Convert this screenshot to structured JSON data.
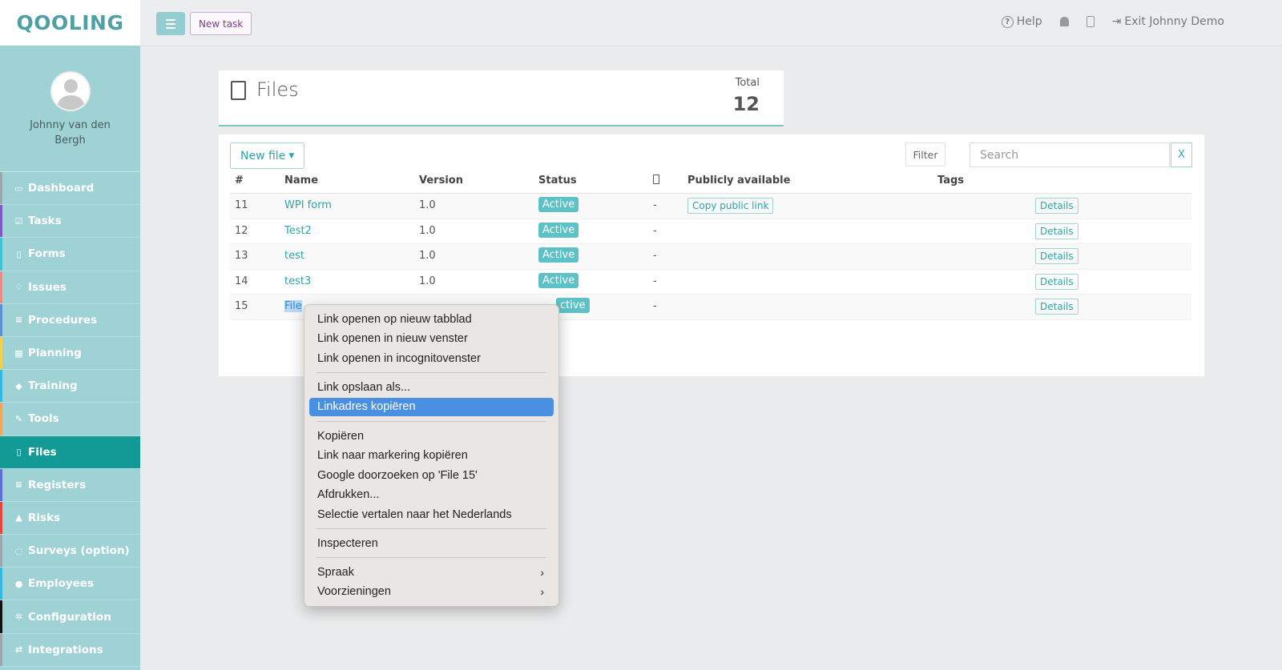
{
  "logo": "QOOLING",
  "user": {
    "name": "Johnny van den Bergh"
  },
  "nav": [
    {
      "label": "Dashboard",
      "icon": "monitor-icon",
      "color": "#9aa7ad"
    },
    {
      "label": "Tasks",
      "icon": "check-square-icon",
      "color": "#7e57c2"
    },
    {
      "label": "Forms",
      "icon": "document-icon",
      "color": "#3fc3d6"
    },
    {
      "label": "Issues",
      "icon": "bell-icon",
      "color": "#e88b86"
    },
    {
      "label": "Procedures",
      "icon": "list-icon",
      "color": "#5b8fd6"
    },
    {
      "label": "Planning",
      "icon": "calendar-icon",
      "color": "#f2d14a"
    },
    {
      "label": "Training",
      "icon": "graduation-cap-icon",
      "color": "#33b8e6"
    },
    {
      "label": "Tools",
      "icon": "wrench-icon",
      "color": "#f0a55c"
    },
    {
      "label": "Files",
      "icon": "pdf-file-icon",
      "color": "#139a97",
      "active": true
    },
    {
      "label": "Registers",
      "icon": "list-icon",
      "color": "#5b6fd6"
    },
    {
      "label": "Risks",
      "icon": "warning-icon",
      "color": "#e8433f"
    },
    {
      "label": "Surveys (option)",
      "icon": "chat-icon",
      "color": "#9aa7ad"
    },
    {
      "label": "Employees",
      "icon": "users-icon",
      "color": "#33b8e6"
    },
    {
      "label": "Configuration",
      "icon": "gear-icon",
      "color": "#111111"
    },
    {
      "label": "Integrations",
      "icon": "exchange-icon",
      "color": "#9aa7ad"
    }
  ],
  "topbar": {
    "new_task": "New task",
    "help": "Help",
    "exit": "Exit Johnny Demo"
  },
  "files_card": {
    "title": "Files",
    "total_label": "Total",
    "total_value": "12"
  },
  "toolbar": {
    "new_file": "New file",
    "filter": "Filter",
    "search_placeholder": "Search",
    "clear": "X"
  },
  "table": {
    "headers": [
      "#",
      "Name",
      "Version",
      "Status",
      "Publicly available",
      "Tags"
    ],
    "rows": [
      {
        "id": "11",
        "name": "WPI form",
        "version": "1.0",
        "status": "Active",
        "mobile": "-",
        "public": "Copy public link",
        "details": "Details"
      },
      {
        "id": "12",
        "name": "Test2",
        "version": "1.0",
        "status": "Active",
        "mobile": "-",
        "public": "",
        "details": "Details"
      },
      {
        "id": "13",
        "name": "test",
        "version": "1.0",
        "status": "Active",
        "mobile": "-",
        "public": "",
        "details": "Details"
      },
      {
        "id": "14",
        "name": "test3",
        "version": "1.0",
        "status": "Active",
        "mobile": "-",
        "public": "",
        "details": "Details"
      },
      {
        "id": "15",
        "name": "File",
        "version": "",
        "status": "ctive",
        "mobile": "-",
        "public": "",
        "details": "Details"
      }
    ]
  },
  "context_menu": {
    "groups": [
      [
        "Link openen op nieuw tabblad",
        "Link openen in nieuw venster",
        "Link openen in incognitovenster"
      ],
      [
        "Link opslaan als...",
        "Linkadres kopiëren"
      ],
      [
        "Kopiëren",
        "Link naar markering kopiëren",
        "Google doorzoeken op 'File 15'",
        "Afdrukken...",
        "Selectie vertalen naar het Nederlands"
      ],
      [
        "Inspecteren"
      ],
      [
        "Spraak",
        "Voorzieningen"
      ]
    ],
    "highlighted": "Linkadres kopiëren"
  }
}
